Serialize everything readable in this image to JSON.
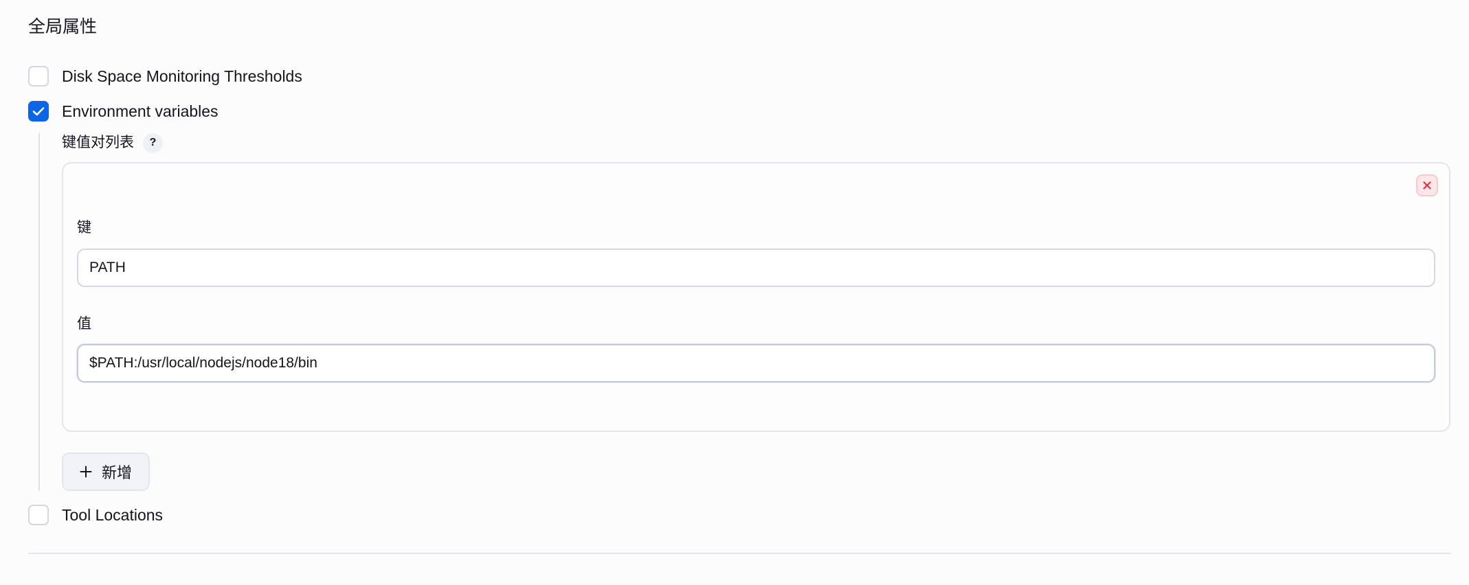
{
  "section": {
    "title": "全局属性"
  },
  "options": {
    "disk_space": {
      "label": "Disk Space Monitoring Thresholds",
      "checked": false
    },
    "env_vars": {
      "label": "Environment variables",
      "checked": true
    },
    "tool_locations": {
      "label": "Tool Locations",
      "checked": false
    }
  },
  "env_vars": {
    "list_label": "键值对列表",
    "help_glyph": "?",
    "entries": [
      {
        "key_label": "键",
        "key_value": "PATH",
        "value_label": "值",
        "value_value": "$PATH:/usr/local/nodejs/node18/bin"
      }
    ],
    "add_button_label": "新增"
  },
  "icons": {
    "check": "check-icon",
    "delete": "close-icon",
    "help": "question-icon",
    "add": "plus-icon"
  },
  "colors": {
    "accent": "#0a66e4",
    "danger": "#e5303f",
    "border": "#d4d7df"
  }
}
